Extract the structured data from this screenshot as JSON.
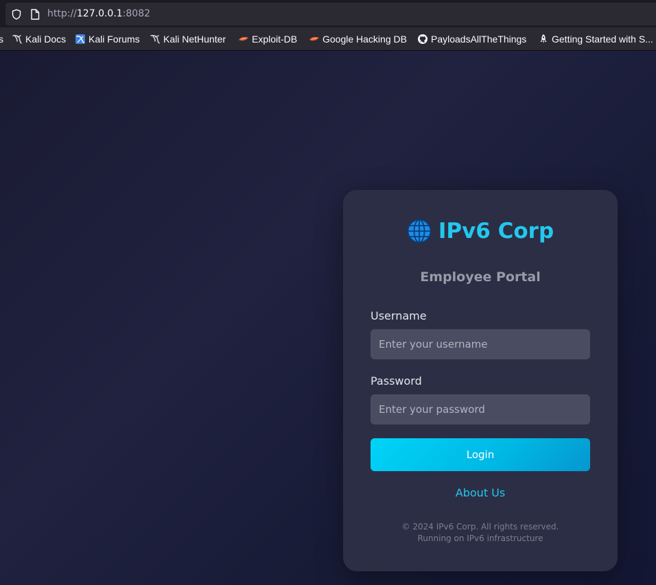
{
  "browser": {
    "url_scheme": "http://",
    "url_host": "127.0.0.1",
    "url_port": ":8082",
    "bookmarks": [
      {
        "label": "s",
        "icon": "none"
      },
      {
        "label": "Kali Docs",
        "icon": "kali-dragon-icon"
      },
      {
        "label": "Kali Forums",
        "icon": "kali-forums-icon"
      },
      {
        "label": "Kali NetHunter",
        "icon": "kali-dragon-icon"
      },
      {
        "label": "Exploit-DB",
        "icon": "exploit-db-icon"
      },
      {
        "label": "Google Hacking DB",
        "icon": "exploit-db-icon"
      },
      {
        "label": "PayloadsAllTheThings",
        "icon": "github-icon"
      },
      {
        "label": "Getting Started with S...",
        "icon": "rocket-icon"
      }
    ]
  },
  "card": {
    "brand": "IPv6 Corp",
    "brand_icon": "globe-icon",
    "subtitle": "Employee Portal",
    "username_label": "Username",
    "username_placeholder": "Enter your username",
    "password_label": "Password",
    "password_placeholder": "Enter your password",
    "login_label": "Login",
    "about_label": "About Us",
    "footer_line1": "© 2024 IPv6 Corp. All rights reserved.",
    "footer_line2": "Running on IPv6 infrastructure"
  },
  "colors": {
    "accent": "#22c8ee",
    "card_bg": "#2c2e45",
    "input_bg": "#4a4c61",
    "page_bg": "#1c1d3a"
  }
}
